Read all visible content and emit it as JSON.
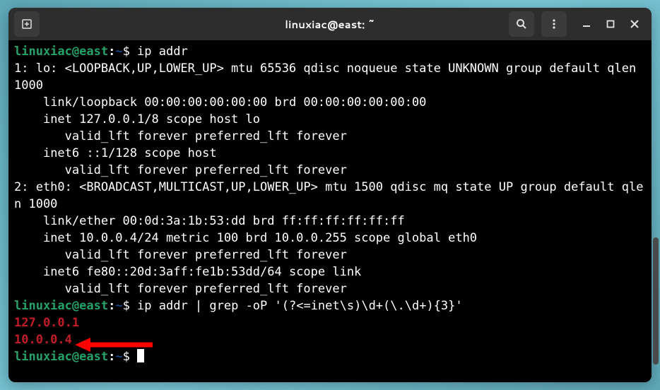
{
  "titlebar": {
    "title": "linuxiac@east: ~"
  },
  "prompt": {
    "user_host": "linuxiac@east",
    "path": "~",
    "symbol": "$"
  },
  "commands": {
    "cmd1": "ip addr",
    "cmd2": "ip addr | grep -oP '(?<=inet\\s)\\d+(\\.\\d+){3}'"
  },
  "output": {
    "l1": "1: lo: <LOOPBACK,UP,LOWER_UP> mtu 65536 qdisc noqueue state UNKNOWN group default qlen 1000",
    "l2": "    link/loopback 00:00:00:00:00:00 brd 00:00:00:00:00:00",
    "l3": "    inet 127.0.0.1/8 scope host lo",
    "l4": "       valid_lft forever preferred_lft forever",
    "l5": "    inet6 ::1/128 scope host",
    "l6": "       valid_lft forever preferred_lft forever",
    "l7": "2: eth0: <BROADCAST,MULTICAST,UP,LOWER_UP> mtu 1500 qdisc mq state UP group default qlen 1000",
    "l8": "    link/ether 00:0d:3a:1b:53:dd brd ff:ff:ff:ff:ff:ff",
    "l9": "    inet 10.0.0.4/24 metric 100 brd 10.0.0.255 scope global eth0",
    "l10": "       valid_lft forever preferred_lft forever",
    "l11": "    inet6 fe80::20d:3aff:fe1b:53dd/64 scope link",
    "l12": "       valid_lft forever preferred_lft forever",
    "grep1": "127.0.0.1",
    "grep2": "10.0.0.4"
  }
}
